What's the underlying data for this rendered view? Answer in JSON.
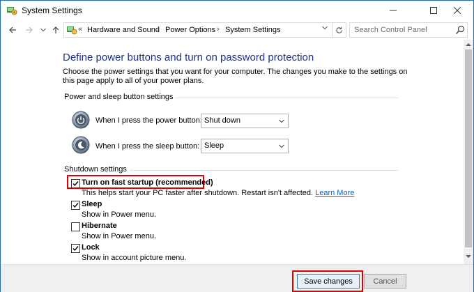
{
  "window": {
    "title": "System Settings"
  },
  "address_bar": {
    "separator": "«",
    "breadcrumbs": [
      "Hardware and Sound",
      "Power Options",
      "System Settings"
    ],
    "search_placeholder": "Search Control Panel"
  },
  "main": {
    "heading": "Define power buttons and turn on password protection",
    "intro": "Choose the power settings that you want for your computer. The changes you make to the settings on this page apply to all of your power plans.",
    "power_section": {
      "title": "Power and sleep button settings",
      "power_button": {
        "label": "When I press the power button:",
        "value": "Shut down",
        "icon": "power-button-icon"
      },
      "sleep_button": {
        "label": "When I press the sleep button:",
        "value": "Sleep",
        "icon": "sleep-button-icon"
      }
    },
    "shutdown_section": {
      "title": "Shutdown settings",
      "options": [
        {
          "label": "Turn on fast startup (recommended)",
          "checked": true,
          "description": "This helps start your PC faster after shutdown. Restart isn't affected.",
          "link": "Learn More"
        },
        {
          "label": "Sleep",
          "checked": true,
          "description": "Show in Power menu."
        },
        {
          "label": "Hibernate",
          "checked": false,
          "description": "Show in Power menu."
        },
        {
          "label": "Lock",
          "checked": true,
          "description": "Show in account picture menu."
        }
      ]
    }
  },
  "footer": {
    "save_label": "Save changes",
    "cancel_label": "Cancel"
  },
  "colors": {
    "heading": "#1e3287",
    "highlight": "#e00000",
    "link": "#0066cc",
    "window_border": "#1f6fb5"
  }
}
